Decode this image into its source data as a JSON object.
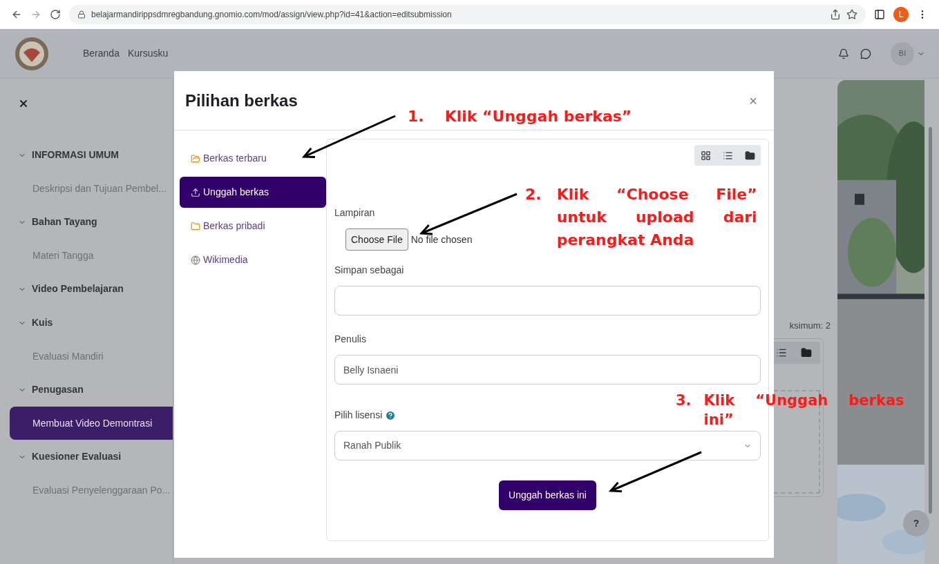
{
  "browser": {
    "url": "belajarmandirippsdmregbandung.gnomio.com/mod/assign/view.php?id=41&action=editsubmission",
    "profile_initial": "L"
  },
  "header": {
    "nav": [
      "Beranda",
      "Kursusku"
    ],
    "avatar_initials": "BI"
  },
  "sidebar": {
    "sections": [
      {
        "label": "INFORMASI UMUM",
        "expanded": true,
        "children": [
          {
            "label": "Deskripsi dan Tujuan Pembel...",
            "selected": false
          }
        ]
      },
      {
        "label": "Bahan Tayang",
        "expanded": true,
        "children": [
          {
            "label": "Materi Tangga",
            "selected": false
          }
        ]
      },
      {
        "label": "Video Pembelajaran",
        "expanded": true
      },
      {
        "label": "Kuis",
        "expanded": true,
        "children": [
          {
            "label": "Evaluasi Mandiri",
            "selected": false
          }
        ]
      },
      {
        "label": "Penugasan",
        "expanded": true,
        "children": [
          {
            "label": "Membuat Video Demontrasi",
            "selected": true
          }
        ]
      },
      {
        "label": "Kuesioner Evaluasi",
        "expanded": true,
        "children": [
          {
            "label": "Evaluasi Penyelenggaraan Po...",
            "selected": false
          }
        ]
      }
    ]
  },
  "background": {
    "partial_text": "ksimum: 2",
    "help_button": "?"
  },
  "modal": {
    "title": "Pilihan berkas",
    "close": "×",
    "repositories": [
      {
        "label": "Berkas terbaru",
        "kind": "recent",
        "selected": false
      },
      {
        "label": "Unggah berkas",
        "kind": "upload",
        "selected": true
      },
      {
        "label": "Berkas pribadi",
        "kind": "private",
        "selected": false
      },
      {
        "label": "Wikimedia",
        "kind": "wikimedia",
        "selected": false
      }
    ],
    "views": [
      {
        "kind": "icons"
      },
      {
        "kind": "list"
      },
      {
        "kind": "tree"
      }
    ],
    "form": {
      "attachment_label": "Lampiran",
      "choose_button": "Choose File",
      "no_file": "No file chosen",
      "save_as_label": "Simpan sebagai",
      "author_label": "Penulis",
      "author_value": "Belly Isnaeni",
      "license_label": "Pilih lisensi",
      "license_value": "Ranah Publik",
      "submit": "Unggah berkas ini"
    }
  },
  "annotations": [
    {
      "number": "1.",
      "text": "Klik “Unggah berkas”"
    },
    {
      "number": "2.",
      "text": "Klik “Choose File” untuk upload dari perangkat Anda"
    },
    {
      "number": "3.",
      "text": "Klik “Unggah berkas ini”"
    }
  ]
}
